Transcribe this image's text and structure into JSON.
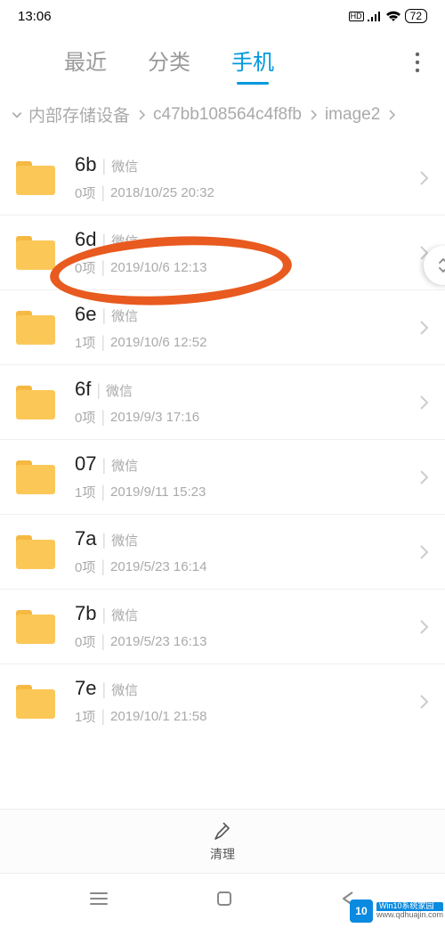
{
  "status": {
    "time": "13:06",
    "battery": "72"
  },
  "tabs": {
    "recent": "最近",
    "category": "分类",
    "phone": "手机"
  },
  "breadcrumb": {
    "a": "内部存储设备",
    "b": "c47bb108564c4f8fb",
    "c": "image2"
  },
  "folders": [
    {
      "name": "6b",
      "source": "微信",
      "count": "0项",
      "date": "2018/10/25 20:32"
    },
    {
      "name": "6d",
      "source": "微信",
      "count": "0项",
      "date": "2019/10/6 12:13"
    },
    {
      "name": "6e",
      "source": "微信",
      "count": "1项",
      "date": "2019/10/6 12:52"
    },
    {
      "name": "6f",
      "source": "微信",
      "count": "0项",
      "date": "2019/9/3 17:16"
    },
    {
      "name": "07",
      "source": "微信",
      "count": "1项",
      "date": "2019/9/11 15:23"
    },
    {
      "name": "7a",
      "source": "微信",
      "count": "0项",
      "date": "2019/5/23 16:14"
    },
    {
      "name": "7b",
      "source": "微信",
      "count": "0项",
      "date": "2019/5/23 16:13"
    },
    {
      "name": "7e",
      "source": "微信",
      "count": "1项",
      "date": "2019/10/1 21:58"
    }
  ],
  "bottom": {
    "clean": "清理"
  },
  "watermark": {
    "badge": "10",
    "line1": "Win10系统家园",
    "line2": "www.qdhuajin.com"
  }
}
